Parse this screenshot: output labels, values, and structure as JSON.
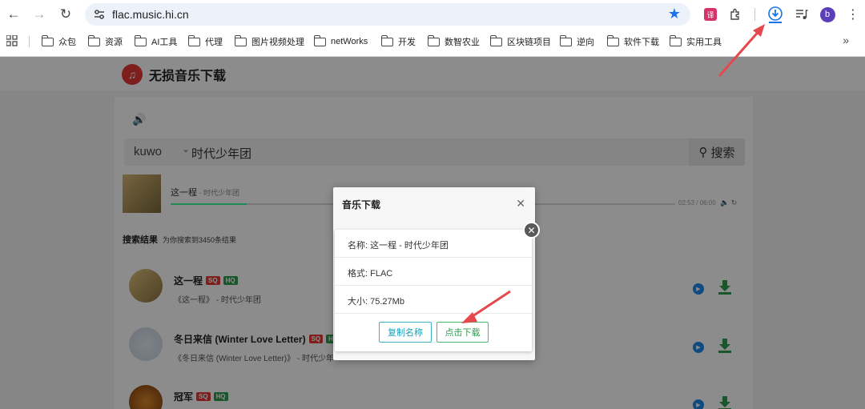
{
  "browser": {
    "url": "flac.music.hi.cn",
    "profile_initial": "b",
    "bookmarks": [
      "众包",
      "资源",
      "AI工具",
      "代理",
      "图片视频处理",
      "netWorks",
      "开发",
      "数智农业",
      "区块链项目",
      "逆向",
      "软件下载",
      "实用工具"
    ],
    "icons": [
      "back-icon",
      "forward-icon",
      "reload-icon",
      "site-settings-icon",
      "star-icon",
      "translate-extension-icon",
      "extensions-icon",
      "downloads-icon",
      "media-control-icon",
      "menu-icon"
    ]
  },
  "site": {
    "title": "无损音乐下载",
    "search": {
      "source": "kuwo",
      "query": "时代少年团",
      "button_label": "搜索"
    },
    "player": {
      "track": "这一程",
      "artist": " - 时代少年团",
      "time": "02:53 / 06:00",
      "progress": 0.15
    },
    "results": {
      "heading": "搜索结果",
      "summary": "为你搜索到3450条结果",
      "songs": [
        {
          "name": "这一程",
          "tags": [
            "SQ",
            "HQ"
          ],
          "album": "《这一程》",
          "artist": " - 时代少年团"
        },
        {
          "name": "冬日来信 (Winter Love Letter)",
          "tags": [
            "SQ",
            "H"
          ],
          "album": "《冬日来信 (Winter Love Letter)》",
          "artist": " - 时代少年"
        },
        {
          "name": "冠军",
          "tags": [
            "SQ",
            "HQ"
          ],
          "album": "",
          "artist": ""
        }
      ]
    }
  },
  "dialog": {
    "title": "音乐下载",
    "name_label": "名称:",
    "name_value": "这一程 - 时代少年团",
    "format_label": "格式:",
    "format_value": "FLAC",
    "size_label": "大小:",
    "size_value": "75.27Mb",
    "copy_button": "复制名称",
    "download_button": "点击下载"
  },
  "colors": {
    "accent_blue": "#1a73e8",
    "tag_sq": "#e53935",
    "tag_hq": "#2e9e4f",
    "arrow": "#e5484d"
  }
}
